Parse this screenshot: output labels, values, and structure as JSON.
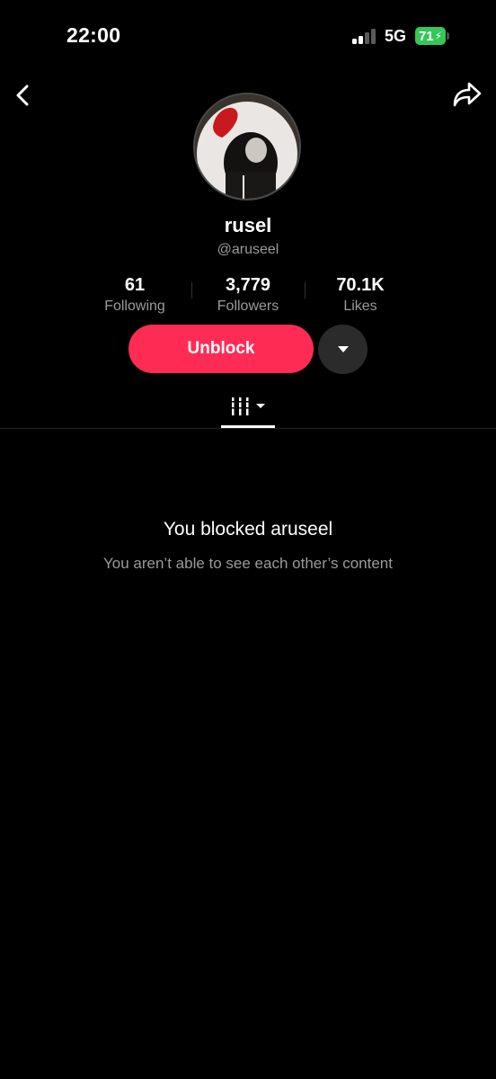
{
  "status_bar": {
    "time": "22:00",
    "network": "5G",
    "battery": "71",
    "battery_color": "#34c759"
  },
  "nav": {
    "back_icon": "chevron-left-icon",
    "share_icon": "share-arrow-icon"
  },
  "profile": {
    "display_name": "rusel",
    "username": "@aruseel",
    "stats": [
      {
        "value": "61",
        "label": "Following"
      },
      {
        "value": "3,779",
        "label": "Followers"
      },
      {
        "value": "70.1K",
        "label": "Likes"
      }
    ]
  },
  "actions": {
    "unblock_label": "Unblock",
    "unblock_color": "#fe2c55",
    "more_icon": "caret-down-icon"
  },
  "tabs": {
    "active_icon": "grid-bars-icon"
  },
  "blocked_notice": {
    "title": "You blocked aruseel",
    "subtitle": "You aren’t able to see each other’s content"
  }
}
